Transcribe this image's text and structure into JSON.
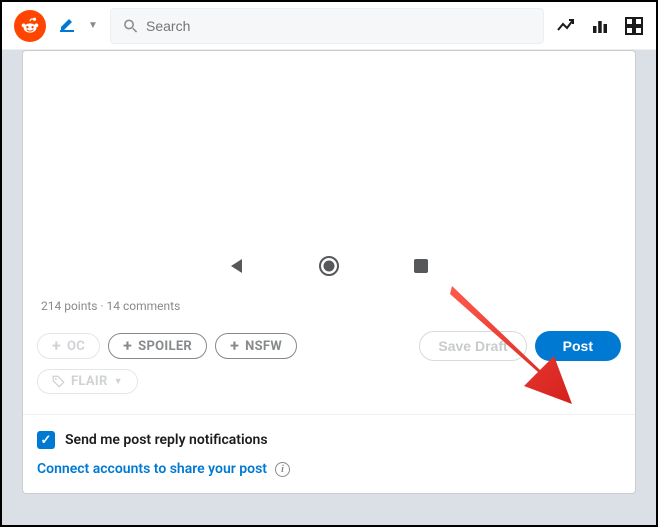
{
  "header": {
    "search_placeholder": "Search"
  },
  "media": {
    "meta": "214 points · 14 comments"
  },
  "tags": {
    "oc": "OC",
    "spoiler": "SPOILER",
    "nsfw": "NSFW",
    "flair": "FLAIR"
  },
  "actions": {
    "save_draft": "Save Draft",
    "post": "Post"
  },
  "notify": {
    "label": "Send me post reply notifications"
  },
  "connect": {
    "label": "Connect accounts to share your post"
  }
}
